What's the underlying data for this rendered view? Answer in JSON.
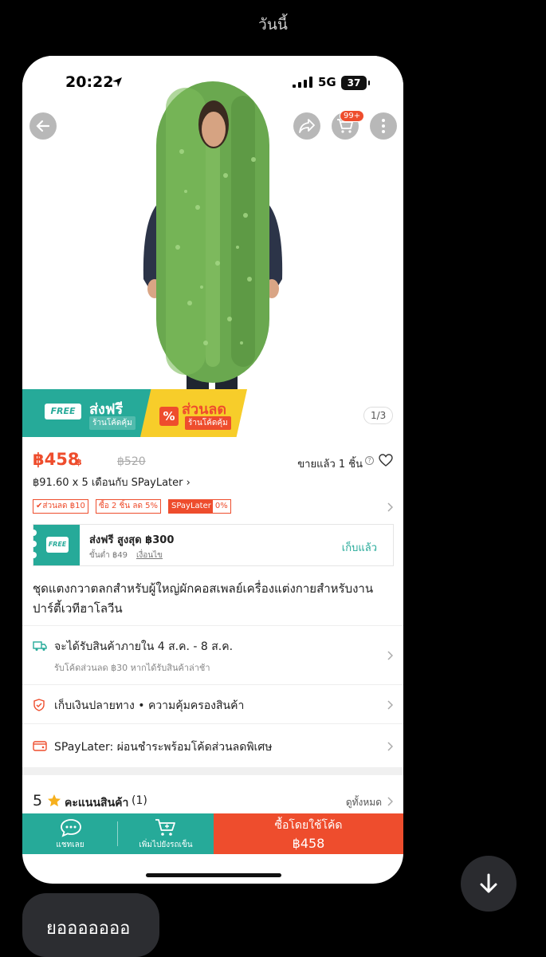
{
  "chat": {
    "day_label": "วันนี้",
    "message": "ยอออออออ"
  },
  "status_bar": {
    "time": "20:22",
    "network": "5G",
    "battery": "37"
  },
  "header": {
    "cart_badge": "99+",
    "image_counter": "1/3"
  },
  "promo": {
    "free_tag": "FREE",
    "free_title": "ส่งฟรี",
    "free_sub": "ร้านโค้ดคุ้ม",
    "discount_symbol": "%",
    "discount_title": "ส่วนลด",
    "discount_sub": "ร้านโค้ดคุ้ม"
  },
  "product": {
    "price": "฿458",
    "price_suffix": "฿",
    "original_price": "฿520",
    "sold": "ขายแล้ว 1 ชิ้น",
    "installment": "฿91.60 x 5 เดือนกับ SPayLater ›",
    "title": "ชุดแตงกวาตลกสำหรับผู้ใหญ่ผักคอสเพลย์เครื่องแต่งกายสำหรับงานปาร์ตี้เวทีฮาโลวีน"
  },
  "vouchers": {
    "tag1": "✔ส่วนลด ฿10",
    "tag2": "ซื้อ 2 ชิ้น ลด 5%",
    "tag3": "SPayLater",
    "tag3_pct": "0%"
  },
  "shipping_voucher": {
    "stub_label": "FREE",
    "title": "ส่งฟรี สูงสุด ฿300",
    "min_spend": "ขั้นต่ำ ฿49",
    "conditions": "เงื่อนไข",
    "action": "เก็บแล้ว"
  },
  "info_rows": {
    "delivery": "จะได้รับสินค้าภายใน 4 ส.ค. - 8 ส.ค.",
    "delivery_sub": "รับโค้ดส่วนลด ฿30 หากได้รับสินค้าล่าช้า",
    "guarantee": "เก็บเงินปลายทาง  •  ความคุ้มครองสินค้า",
    "spaylater": "SPayLater: ผ่อนชำระพร้อมโค้ดส่วนลดพิเศษ"
  },
  "rating": {
    "score": "5",
    "label": "คะแนนสินค้า",
    "count": "(1)",
    "see_all": "ดูทั้งหมด"
  },
  "bottom_bar": {
    "chat": "แชทเลย",
    "add_to_cart": "เพิ่มไปยังรถเข็น",
    "buy_label": "ซื้อโดยใช้โค้ด",
    "buy_price": "฿458"
  },
  "colors": {
    "brand": "#ee4d2d",
    "teal": "#26aa99",
    "yellow": "#f7cd2a"
  }
}
